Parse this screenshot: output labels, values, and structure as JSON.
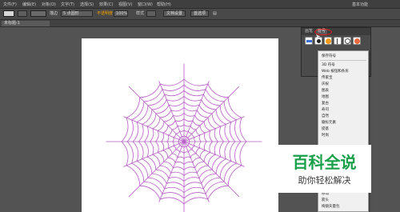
{
  "menubar": {
    "items": [
      "文件(F)",
      "编辑(E)",
      "对象(O)",
      "文字(T)",
      "选择(S)",
      "效果(C)",
      "视图(V)",
      "窗口(W)",
      "帮助(H)"
    ],
    "workspace": "基本功能"
  },
  "options": {
    "stroke_label": "描边",
    "brush": "5 点圆形",
    "opacity_label": "不透明度",
    "opacity": "100%",
    "style_label": "样式",
    "doc_setup": "文档设置",
    "prefs": "首选项"
  },
  "doc_tab": {
    "title": "未标题-1"
  },
  "symbols_panel": {
    "tabs": [
      "画笔",
      "符号"
    ],
    "symbol_colors": [
      "#3a6fd8",
      "#222222",
      "#f29a1e",
      "#ffffff",
      "#444444",
      "#e96a3a"
    ]
  },
  "library_menu": {
    "items": [
      "保存符号",
      "3D 符号",
      "Web 按钮和条形",
      "传家宝",
      "庆祝",
      "图表",
      "地图",
      "复古",
      "寿司",
      "自然",
      "徽标元素",
      "提基",
      "时尚",
      "",
      "",
      "",
      "",
      "",
      "",
      "",
      "",
      "",
      "",
      "移动",
      "箭头",
      "绚丽矢量包"
    ]
  },
  "watermark": {
    "title": "百科全说",
    "subtitle": "助你轻松解决"
  }
}
